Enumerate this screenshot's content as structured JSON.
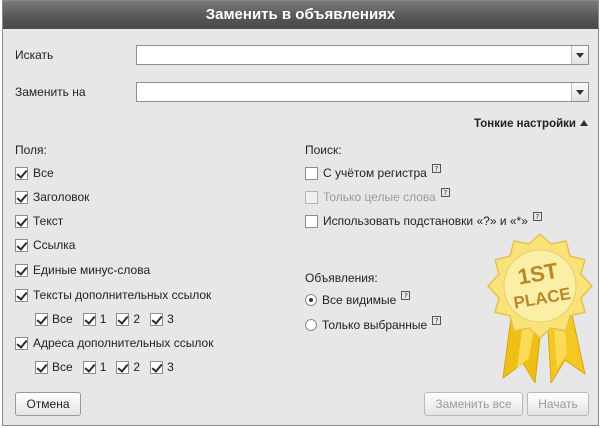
{
  "dialog": {
    "title": "Заменить в объявлениях"
  },
  "search": {
    "label": "Искать",
    "value": ""
  },
  "replace": {
    "label": "Заменить на",
    "value": ""
  },
  "fine_settings": {
    "label": "Тонкие настройки"
  },
  "fields": {
    "heading": "Поля:",
    "items": [
      {
        "label": "Все",
        "checked": true
      },
      {
        "label": "Заголовок",
        "checked": true
      },
      {
        "label": "Текст",
        "checked": true
      },
      {
        "label": "Ссылка",
        "checked": true
      },
      {
        "label": "Единые минус-слова",
        "checked": true
      },
      {
        "label": "Тексты дополнительных ссылок",
        "checked": true
      },
      {
        "label": "Адреса дополнительных ссылок",
        "checked": true
      }
    ],
    "sub_options": [
      "Все",
      "1",
      "2",
      "3"
    ]
  },
  "search_options": {
    "heading": "Поиск:",
    "items": [
      {
        "label": "С учётом регистра",
        "checked": false,
        "disabled": false,
        "help": "?"
      },
      {
        "label": "Только целые слова",
        "checked": false,
        "disabled": true,
        "help": "?"
      },
      {
        "label": "Использовать подстановки «?» и «*»",
        "checked": false,
        "disabled": false,
        "help": "?"
      }
    ]
  },
  "ads": {
    "heading": "Объявления:",
    "items": [
      {
        "label": "Все видимые",
        "selected": true,
        "help": "?"
      },
      {
        "label": "Только выбранные",
        "selected": false,
        "help": "?"
      }
    ]
  },
  "buttons": {
    "cancel": "Отмена",
    "replace_all": "Заменить все",
    "start": "Начать"
  },
  "badge": {
    "line1": "1ST",
    "line2": "PLACE",
    "colors": {
      "rosette": "#f7e28a",
      "ribbon": "#f2c21a",
      "text": "#b8892b"
    }
  }
}
